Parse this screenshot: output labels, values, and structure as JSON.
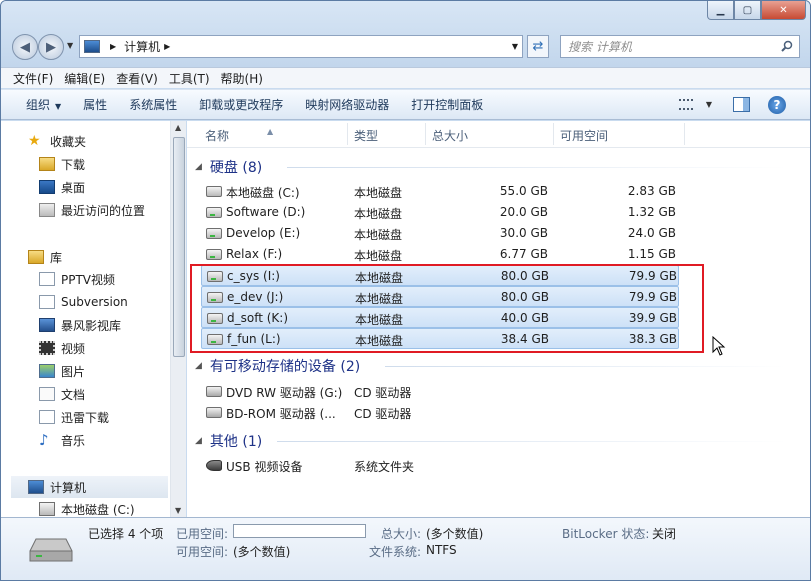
{
  "window": {
    "min": "▭",
    "max": "□",
    "close": "✕"
  },
  "address": {
    "crumb": "计算机",
    "search_placeholder": "搜索 计算机"
  },
  "menu": [
    "文件(F)",
    "编辑(E)",
    "查看(V)",
    "工具(T)",
    "帮助(H)"
  ],
  "toolbar": {
    "organize": "组织",
    "properties": "属性",
    "system_properties": "系统属性",
    "uninstall": "卸载或更改程序",
    "map_drive": "映射网络驱动器",
    "control_panel": "打开控制面板"
  },
  "nav": {
    "favorites": "收藏夹",
    "downloads": "下载",
    "desktop": "桌面",
    "recent": "最近访问的位置",
    "libraries": "库",
    "pptv": "PPTV视频",
    "subversion": "Subversion",
    "baofeng": "暴风影视库",
    "videos": "视频",
    "pictures": "图片",
    "documents": "文档",
    "xunlei": "迅雷下载",
    "music": "音乐",
    "computer": "计算机",
    "c_drive": "本地磁盘 (C:)"
  },
  "columns": {
    "name": "名称",
    "type": "类型",
    "total": "总大小",
    "free": "可用空间"
  },
  "groups": {
    "hdd": "硬盘 (8)",
    "removable": "有可移动存储的设备 (2)",
    "other": "其他 (1)"
  },
  "drives": [
    {
      "name": "本地磁盘 (C:)",
      "type": "本地磁盘",
      "total": "55.0 GB",
      "free": "2.83 GB"
    },
    {
      "name": "Software (D:)",
      "type": "本地磁盘",
      "total": "20.0 GB",
      "free": "1.32 GB"
    },
    {
      "name": "Develop (E:)",
      "type": "本地磁盘",
      "total": "30.0 GB",
      "free": "24.0 GB"
    },
    {
      "name": "Relax (F:)",
      "type": "本地磁盘",
      "total": "6.77 GB",
      "free": "1.15 GB"
    },
    {
      "name": "c_sys (I:)",
      "type": "本地磁盘",
      "total": "80.0 GB",
      "free": "79.9 GB"
    },
    {
      "name": "e_dev (J:)",
      "type": "本地磁盘",
      "total": "80.0 GB",
      "free": "79.9 GB"
    },
    {
      "name": "d_soft (K:)",
      "type": "本地磁盘",
      "total": "40.0 GB",
      "free": "39.9 GB"
    },
    {
      "name": "f_fun (L:)",
      "type": "本地磁盘",
      "total": "38.4 GB",
      "free": "38.3 GB"
    }
  ],
  "removable": [
    {
      "name": "DVD RW 驱动器 (G:)",
      "type": "CD 驱动器"
    },
    {
      "name": "BD-ROM 驱动器 (...",
      "type": "CD 驱动器"
    }
  ],
  "other": [
    {
      "name": "USB 视频设备",
      "type": "系统文件夹"
    }
  ],
  "details": {
    "selected": "已选择 4 个项",
    "used_label": "已用空间:",
    "free_label": "可用空间:",
    "free_value": "(多个数值)",
    "total_label": "总大小:",
    "total_value": "(多个数值)",
    "fs_label": "文件系统:",
    "fs_value": "NTFS",
    "bitlocker_label": "BitLocker 状态:",
    "bitlocker_value": "关闭"
  }
}
